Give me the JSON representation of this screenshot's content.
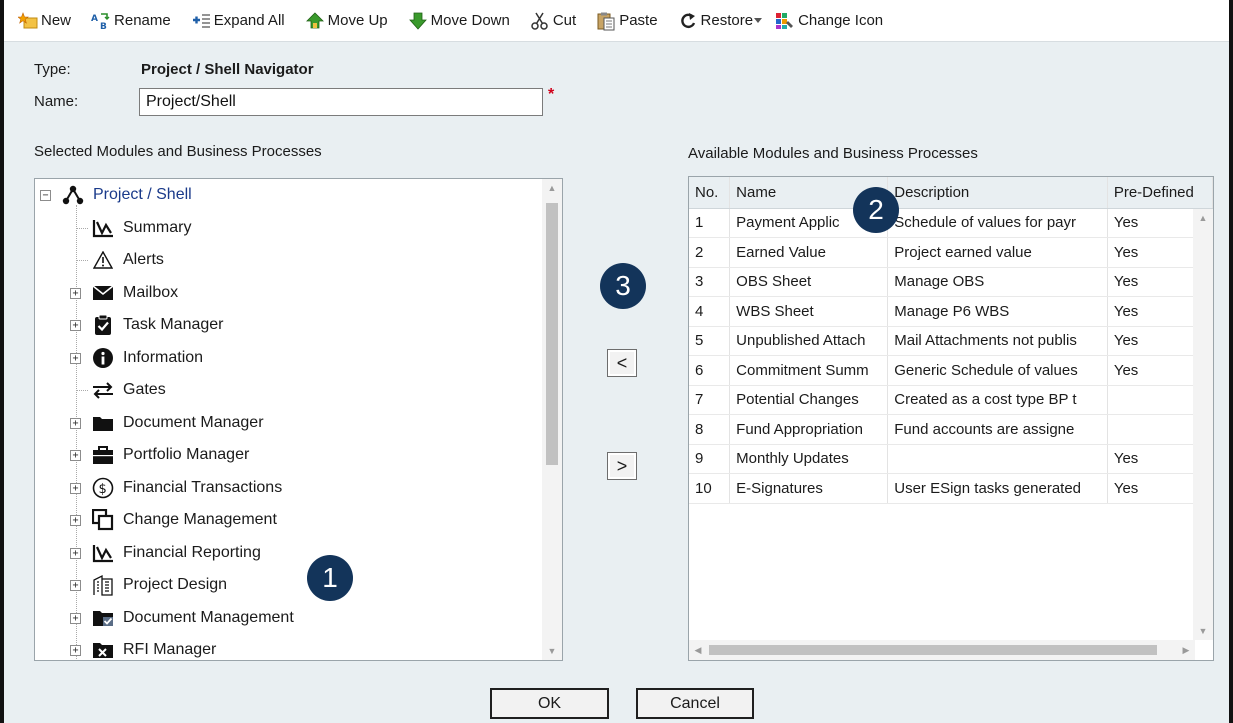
{
  "toolbar": {
    "new": "New",
    "rename": "Rename",
    "expand_all": "Expand All",
    "move_up": "Move Up",
    "move_down": "Move Down",
    "cut": "Cut",
    "paste": "Paste",
    "restore": "Restore",
    "change_icon": "Change Icon"
  },
  "form": {
    "type_label": "Type:",
    "type_value": "Project / Shell Navigator",
    "name_label": "Name:",
    "name_value": "Project/Shell",
    "required_mark": "*"
  },
  "selected": {
    "title": "Selected Modules and Business Processes",
    "root": "Project / Shell",
    "items": [
      {
        "label": "Summary",
        "icon": "chart-icon",
        "expandable": false
      },
      {
        "label": "Alerts",
        "icon": "warning-icon",
        "expandable": false
      },
      {
        "label": "Mailbox",
        "icon": "envelope-icon",
        "expandable": true
      },
      {
        "label": "Task Manager",
        "icon": "clipboard-check-icon",
        "expandable": true
      },
      {
        "label": "Information",
        "icon": "info-icon",
        "expandable": true
      },
      {
        "label": "Gates",
        "icon": "swap-arrows-icon",
        "expandable": false
      },
      {
        "label": "Document Manager",
        "icon": "folder-icon",
        "expandable": true
      },
      {
        "label": "Portfolio Manager",
        "icon": "briefcase-icon",
        "expandable": true
      },
      {
        "label": "Financial Transactions",
        "icon": "dollar-circle-icon",
        "expandable": true
      },
      {
        "label": "Change Management",
        "icon": "copy-icon",
        "expandable": true
      },
      {
        "label": "Financial Reporting",
        "icon": "chart-icon",
        "expandable": true
      },
      {
        "label": "Project Design",
        "icon": "building-icon",
        "expandable": true
      },
      {
        "label": "Document Management",
        "icon": "folder-check-icon",
        "expandable": true
      },
      {
        "label": "RFI Manager",
        "icon": "folder-x-icon",
        "expandable": true
      }
    ]
  },
  "available": {
    "title": "Available Modules and Business Processes",
    "columns": [
      "No.",
      "Name",
      "Description",
      "Pre-Defined"
    ],
    "rows": [
      [
        "1",
        "Payment Applic",
        "Schedule of values for payr",
        "Yes"
      ],
      [
        "2",
        "Earned Value",
        "Project earned value",
        "Yes"
      ],
      [
        "3",
        "OBS Sheet",
        "Manage OBS",
        "Yes"
      ],
      [
        "4",
        "WBS Sheet",
        "Manage P6 WBS",
        "Yes"
      ],
      [
        "5",
        "Unpublished Attach",
        "Mail Attachments not publis",
        "Yes"
      ],
      [
        "6",
        "Commitment Summ",
        "Generic Schedule of values",
        "Yes"
      ],
      [
        "7",
        "Potential Changes",
        "Created as a cost type BP t",
        ""
      ],
      [
        "8",
        "Fund Appropriation",
        "Fund accounts are assigne",
        ""
      ],
      [
        "9",
        "Monthly Updates",
        "",
        "Yes"
      ],
      [
        "10",
        "E-Signatures",
        "User ESign tasks generated",
        "Yes"
      ]
    ]
  },
  "transfer": {
    "add": "<",
    "remove": ">"
  },
  "callouts": [
    "1",
    "2",
    "3"
  ],
  "footer": {
    "ok": "OK",
    "cancel": "Cancel"
  },
  "colors": {
    "accent": "#13345a",
    "background": "#e9eff2",
    "required": "#d0021b"
  }
}
